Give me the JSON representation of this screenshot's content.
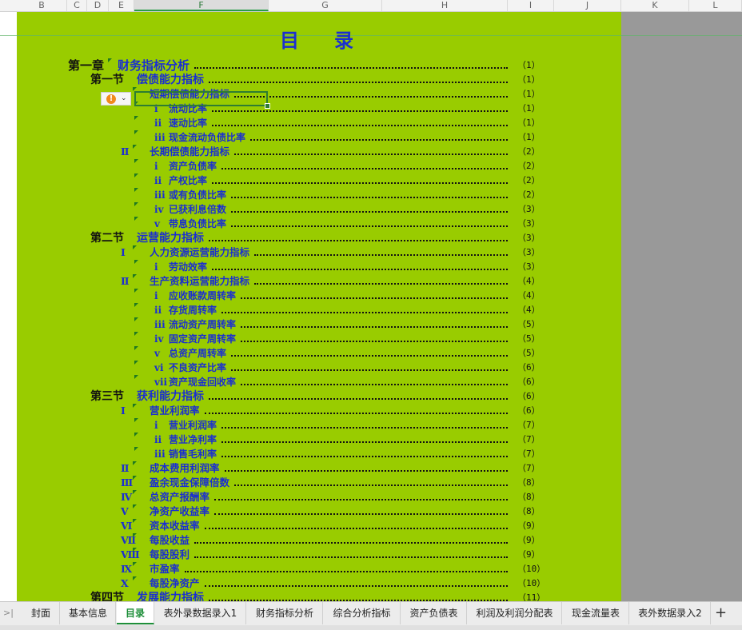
{
  "columns": [
    "B",
    "C",
    "D",
    "E",
    "F",
    "G",
    "H",
    "I",
    "J",
    "K",
    "L"
  ],
  "selected_column": "F",
  "title": "目　录",
  "toc": [
    {
      "prefix": "第一章",
      "label": "财务指标分析",
      "page": "（1）",
      "level": 1
    },
    {
      "prefix": "第一节",
      "label": "偿债能力指标",
      "page": "（1）",
      "level": 2
    },
    {
      "prefix": "",
      "label": "短期偿债能力指标",
      "page": "（1）",
      "level": 3
    },
    {
      "prefix": "ⅰ",
      "label": "流动比率",
      "page": "（1）",
      "level": 4
    },
    {
      "prefix": "ⅱ",
      "label": "速动比率",
      "page": "（1）",
      "level": 4
    },
    {
      "prefix": "ⅲ",
      "label": "现金流动负债比率",
      "page": "（1）",
      "level": 4
    },
    {
      "prefix": "Ⅱ",
      "label": "长期偿债能力指标",
      "page": "（2）",
      "level": 3
    },
    {
      "prefix": "ⅰ",
      "label": "资产负债率",
      "page": "（2）",
      "level": 4
    },
    {
      "prefix": "ⅱ",
      "label": "产权比率",
      "page": "（2）",
      "level": 4
    },
    {
      "prefix": "ⅲ",
      "label": "或有负债比率",
      "page": "（2）",
      "level": 4
    },
    {
      "prefix": "ⅳ",
      "label": "已获利息倍数",
      "page": "（3）",
      "level": 4
    },
    {
      "prefix": "ⅴ",
      "label": "带息负债比率",
      "page": "（3）",
      "level": 4
    },
    {
      "prefix": "第二节",
      "label": "运营能力指标",
      "page": "（3）",
      "level": 2
    },
    {
      "prefix": "Ⅰ",
      "label": "人力资源运营能力指标",
      "page": "（3）",
      "level": 3
    },
    {
      "prefix": "ⅰ",
      "label": "劳动效率",
      "page": "（3）",
      "level": 4
    },
    {
      "prefix": "Ⅱ",
      "label": "生产资料运营能力指标",
      "page": "（4）",
      "level": 3
    },
    {
      "prefix": "ⅰ",
      "label": "应收账款周转率",
      "page": "（4）",
      "level": 4
    },
    {
      "prefix": "ⅱ",
      "label": "存货周转率",
      "page": "（4）",
      "level": 4
    },
    {
      "prefix": "ⅲ",
      "label": "流动资产周转率",
      "page": "（5）",
      "level": 4
    },
    {
      "prefix": "ⅳ",
      "label": "固定资产周转率",
      "page": "（5）",
      "level": 4
    },
    {
      "prefix": "ⅴ",
      "label": "总资产周转率",
      "page": "（5）",
      "level": 4
    },
    {
      "prefix": "ⅵ",
      "label": "不良资产比率",
      "page": "（6）",
      "level": 4
    },
    {
      "prefix": "ⅶ",
      "label": "资产现金回收率",
      "page": "（6）",
      "level": 4
    },
    {
      "prefix": "第三节",
      "label": "获利能力指标",
      "page": "（6）",
      "level": 2
    },
    {
      "prefix": "Ⅰ",
      "label": "营业利润率",
      "page": "（6）",
      "level": 3
    },
    {
      "prefix": "ⅰ",
      "label": "营业利润率",
      "page": "（7）",
      "level": 4
    },
    {
      "prefix": "ⅱ",
      "label": "营业净利率",
      "page": "（7）",
      "level": 4
    },
    {
      "prefix": "ⅲ",
      "label": "销售毛利率",
      "page": "（7）",
      "level": 4
    },
    {
      "prefix": "Ⅱ",
      "label": "成本费用利润率",
      "page": "（7）",
      "level": 3
    },
    {
      "prefix": "Ⅲ",
      "label": "盈余现金保障倍数",
      "page": "（8）",
      "level": 3
    },
    {
      "prefix": "Ⅳ",
      "label": "总资产报酬率",
      "page": "（8）",
      "level": 3
    },
    {
      "prefix": "Ⅴ",
      "label": "净资产收益率",
      "page": "（8）",
      "level": 3
    },
    {
      "prefix": "Ⅵ",
      "label": "资本收益率",
      "page": "（9）",
      "level": 3
    },
    {
      "prefix": "Ⅶ",
      "label": "每股收益",
      "page": "（9）",
      "level": 3
    },
    {
      "prefix": "Ⅷ",
      "label": "每股股利",
      "page": "（9）",
      "level": 3
    },
    {
      "prefix": "Ⅸ",
      "label": "市盈率",
      "page": "（10）",
      "level": 3
    },
    {
      "prefix": "Ⅹ",
      "label": "每股净资产",
      "page": "（10）",
      "level": 3
    },
    {
      "prefix": "第四节",
      "label": "发展能力指标",
      "page": "（11）",
      "level": 2
    }
  ],
  "error_icon": "exclamation-circle-icon",
  "tabs": [
    "封面",
    "基本信息",
    "目录",
    "表外录数据录入1",
    "财务指标分析",
    "综合分析指标",
    "资产负债表",
    "利润及利润分配表",
    "现金流量表",
    "表外数据录入2"
  ],
  "active_tab": 2,
  "colors": {
    "sheet_green": "#99cc00",
    "toc_text": "#1a2fd0",
    "active_tab": "#1f8f3a"
  }
}
